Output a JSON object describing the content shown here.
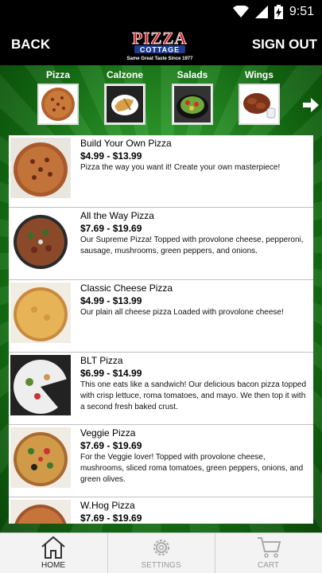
{
  "status_bar": {
    "time": "9:51"
  },
  "header": {
    "back_label": "BACK",
    "signout_label": "SIGN OUT",
    "logo": {
      "line1": "PIZZA",
      "line2": "COTTAGE",
      "tagline": "Same Great Taste Since 1977"
    }
  },
  "categories": [
    {
      "label": "Pizza"
    },
    {
      "label": "Calzone"
    },
    {
      "label": "Salads"
    },
    {
      "label": "Wings"
    }
  ],
  "items": [
    {
      "name": "Build Your Own Pizza",
      "price": "$4.99 - $13.99",
      "description": "Pizza the way you want it! Create your own masterpiece!"
    },
    {
      "name": "All the Way Pizza",
      "price": "$7.69 - $19.69",
      "description": "Our Supreme Pizza! Topped with provolone cheese, pepperoni, sausage, mushrooms, green peppers, and onions."
    },
    {
      "name": "Classic Cheese Pizza",
      "price": "$4.99 - $13.99",
      "description": "Our plain all cheese pizza Loaded with provolone cheese!"
    },
    {
      "name": "BLT Pizza",
      "price": "$6.99 - $14.99",
      "description": "This one eats like a sandwich! Our delicious bacon pizza topped with crisp lettuce, roma tomatoes, and mayo. We then top it with a second fresh baked crust."
    },
    {
      "name": "Veggie Pizza",
      "price": "$7.69 - $19.69",
      "description": "For the Veggie lover! Topped with provolone cheese, mushrooms, sliced roma tomatoes, green peppers, onions, and green olives."
    },
    {
      "name": "W.Hog Pizza",
      "price": "$7.69 - $19.69",
      "description": ""
    }
  ],
  "tabs": {
    "home": "HOME",
    "settings": "SETTINGS",
    "cart": "CART"
  },
  "colors": {
    "brand_red": "#d7191f",
    "brand_blue": "#1f3b8f",
    "bg_green": "#2f9d2c"
  }
}
